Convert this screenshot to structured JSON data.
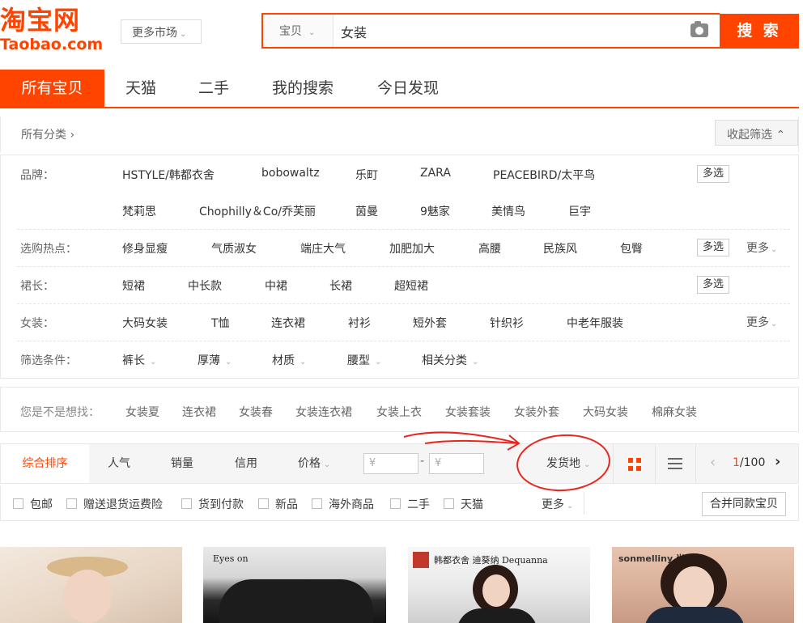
{
  "header": {
    "logo_cn": "淘宝网",
    "logo_en": "Taobao.com",
    "market_label": "更多市场",
    "search_category": "宝贝",
    "search_query": "女装",
    "search_button": "搜 索"
  },
  "tabs": [
    "所有宝贝",
    "天猫",
    "二手",
    "我的搜索",
    "今日发现"
  ],
  "filters": {
    "crumb": "所有分类 ›",
    "collapse": "收起筛选 ⌃",
    "multi_label": "多选",
    "more_label": "更多",
    "brand": {
      "label": "品牌：",
      "row1": [
        "HSTYLE/韩都衣舍",
        "bobowaltz",
        "乐町",
        "ZARA",
        "PEACEBIRD/太平鸟"
      ],
      "row2": [
        "梵莉思",
        "Chophilly＆Co/乔芙丽",
        "茵曼",
        "9魅家",
        "美情鸟",
        "巨宇"
      ]
    },
    "hot": {
      "label": "选购热点：",
      "items": [
        "修身显瘦",
        "气质淑女",
        "端庄大气",
        "加肥加大",
        "高腰",
        "民族风",
        "包臀"
      ]
    },
    "skirt": {
      "label": "裙长：",
      "items": [
        "短裙",
        "中长款",
        "中裙",
        "长裙",
        "超短裙"
      ]
    },
    "women": {
      "label": "女装：",
      "items": [
        "大码女装",
        "T恤",
        "连衣裙",
        "衬衫",
        "短外套",
        "针织衫",
        "中老年服装"
      ]
    },
    "conditions": {
      "label": "筛选条件：",
      "items": [
        "裤长",
        "厚薄",
        "材质",
        "腰型",
        "相关分类"
      ]
    }
  },
  "suggest": {
    "label": "您是不是想找：",
    "keywords": [
      "女装夏",
      "连衣裙",
      "女装春",
      "女装连衣裙",
      "女装上衣",
      "女装套装",
      "女装外套",
      "大码女装",
      "棉麻女装"
    ]
  },
  "sortbar": {
    "items": [
      "综合排序",
      "人气",
      "销量",
      "信用",
      "价格"
    ],
    "price_placeholder": "¥",
    "dash": "-",
    "ship_from": "发货地",
    "page_current": "1",
    "page_total": "/100"
  },
  "checks": {
    "items": [
      "包邮",
      "赠送退货运费险",
      "货到付款",
      "新品",
      "海外商品",
      "二手",
      "天猫"
    ],
    "more": "更多",
    "merge": "合并同款宝贝"
  },
  "products": {
    "p2_brand": "Eyes on",
    "p3_brand": "韩都衣舍 迪葵纳 Dequanna",
    "p4_brand": "sonmelliny 尚曼妮"
  },
  "colors": {
    "accent": "#ff4400",
    "annotation": "#e8261f"
  },
  "icons": [
    "camera-icon",
    "chevron-down-icon",
    "grid-view-icon",
    "list-view-icon",
    "chevron-left-icon",
    "chevron-right-icon"
  ]
}
